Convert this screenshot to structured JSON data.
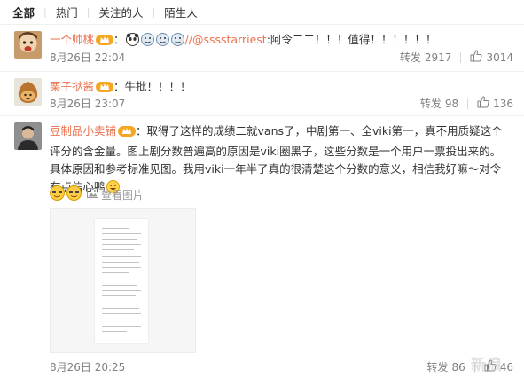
{
  "tabs": [
    "全部",
    "热门",
    "关注的人",
    "陌生人"
  ],
  "comments": [
    {
      "user": "一个帅桃",
      "pre_mention": "：",
      "mention": "//@sssstarriest",
      "text": ":阿令二二！！！值得！！！！！！",
      "date": "8月26日 22:04",
      "repost_label": "转发",
      "repost_count": "2917",
      "like_count": "3014"
    },
    {
      "user": "栗子挞酱",
      "text": "：牛批！！！！",
      "date": "8月26日 23:07",
      "repost_label": "转发",
      "repost_count": "98",
      "like_count": "136"
    },
    {
      "user": "豆制品小卖铺",
      "text": "：取得了这样的成绩二就vans了，中剧第一、全viki第一，真不用质疑这个评分的含金量。图上剧分数普遍高的原因是viki圈黑子，这些分数是一个用户一票投出来的。具体原因和参考标准见图。我用viki一年半了真的很清楚这个分数的意义，相信我好嘛～对令有点信心鸭",
      "view_image_label": "查看图片",
      "date": "8月26日 20:25",
      "repost_label": "转发",
      "repost_count": "86",
      "like_count": "46"
    }
  ],
  "watermark": "新浪",
  "colors": {
    "username": "#eb7350",
    "meta": "#808080",
    "badge": "#f5a623"
  },
  "icons": [
    "crown-badge-icon",
    "emoji-icon",
    "like-icon",
    "image-icon"
  ]
}
